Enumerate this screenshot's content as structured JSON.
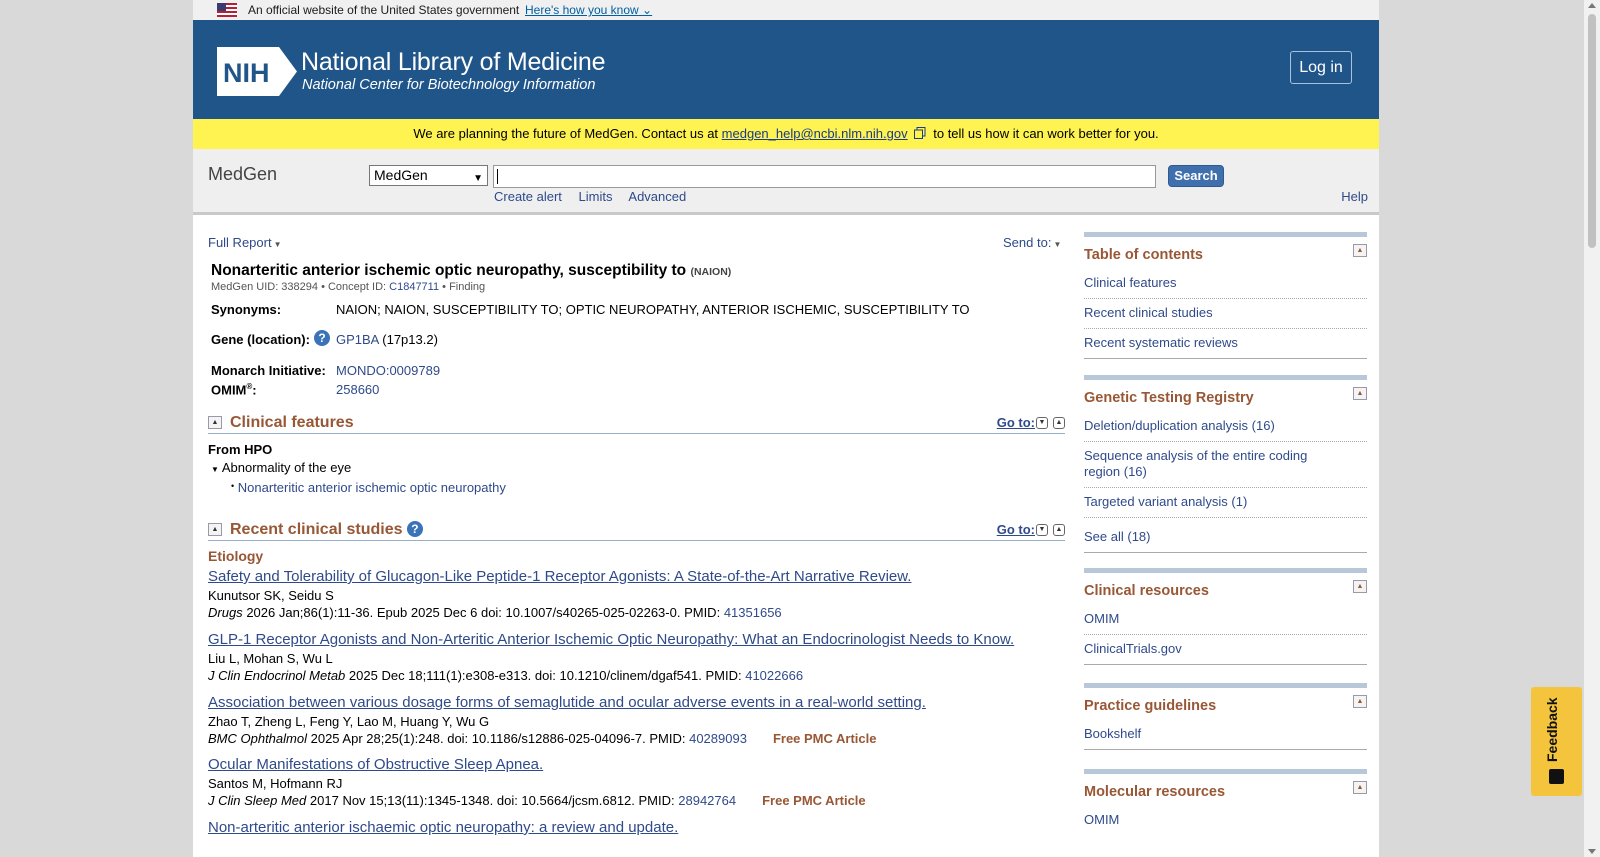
{
  "gov_banner": {
    "text": "An official website of the United States government",
    "link": "Here's how you know"
  },
  "header": {
    "logo_text": "NIH",
    "title": "National Library of Medicine",
    "subtitle": "National Center for Biotechnology Information",
    "login": "Log in"
  },
  "notice": {
    "before": "We are planning the future of MedGen. Contact us at",
    "email": "medgen_help@ncbi.nlm.nih.gov",
    "after": "to tell us how it can work better for you."
  },
  "search": {
    "db_name": "MedGen",
    "db_selected": "MedGen",
    "value": "",
    "button": "Search",
    "links": [
      "Create alert",
      "Limits",
      "Advanced"
    ],
    "help": "Help"
  },
  "report": {
    "format": "Full Report",
    "send_to": "Send to:",
    "title": "Nonarteritic anterior ischemic optic neuropathy, susceptibility to",
    "abbrev": "(NAION)",
    "uid_label": "MedGen UID: 338294",
    "concept_label": "Concept ID:",
    "concept_id": "C1847711",
    "type": "Finding",
    "synonyms_label": "Synonyms:",
    "synonyms": "NAION; NAION, SUSCEPTIBILITY TO; OPTIC NEUROPATHY, ANTERIOR ISCHEMIC, SUSCEPTIBILITY TO",
    "gene_label": "Gene (location):",
    "gene": "GP1BA",
    "gene_location": "(17p13.2)",
    "monarch_label": "Monarch Initiative:",
    "monarch_id": "MONDO:0009789",
    "omim_label": "OMIM",
    "omim_reg": "®",
    "omim_colon": ":",
    "omim_id": "258660"
  },
  "clinical_features": {
    "heading": "Clinical features",
    "goto": "Go to:",
    "from": "From HPO",
    "parent": "Abnormality of the eye",
    "child": "Nonarteritic anterior ischemic optic neuropathy"
  },
  "recent_studies": {
    "heading": "Recent clinical studies",
    "goto": "Go to:",
    "subheading": "Etiology",
    "items": [
      {
        "title": "Safety and Tolerability of Glucagon-Like Peptide-1 Receptor Agonists: A State-of-the-Art Narrative Review.",
        "authors": "Kunutsor SK, Seidu S",
        "journal": "Drugs",
        "cite": "2026 Jan;86(1):11-36. Epub 2025 Dec 6 doi: 10.1007/s40265-025-02263-0. PMID:",
        "pmid": "41351656",
        "free": ""
      },
      {
        "title": "GLP-1 Receptor Agonists and Non-Arteritic Anterior Ischemic Optic Neuropathy: What an Endocrinologist Needs to Know.",
        "authors": "Liu L, Mohan S, Wu L",
        "journal": "J Clin Endocrinol Metab",
        "cite": "2025 Dec 18;111(1):e308-e313. doi: 10.1210/clinem/dgaf541. PMID:",
        "pmid": "41022666",
        "free": ""
      },
      {
        "title": "Association between various dosage forms of semaglutide and ocular adverse events in a real-world setting.",
        "authors": "Zhao T, Zheng L, Feng Y, Lao M, Huang Y, Wu G",
        "journal": "BMC Ophthalmol",
        "cite": "2025 Apr 28;25(1):248. doi: 10.1186/s12886-025-04096-7. PMID:",
        "pmid": "40289093",
        "free": "Free PMC Article"
      },
      {
        "title": "Ocular Manifestations of Obstructive Sleep Apnea.",
        "authors": "Santos M, Hofmann RJ",
        "journal": "J Clin Sleep Med",
        "cite": "2017 Nov 15;13(11):1345-1348. doi: 10.5664/jcsm.6812. PMID:",
        "pmid": "28942764",
        "free": "Free PMC Article"
      },
      {
        "title": "Non-arteritic anterior ischaemic optic neuropathy: a review and update.",
        "authors": "",
        "journal": "",
        "cite": "",
        "pmid": "",
        "free": ""
      }
    ]
  },
  "sidebar": {
    "toc": {
      "heading": "Table of contents",
      "items": [
        "Clinical features",
        "Recent clinical studies",
        "Recent systematic reviews"
      ]
    },
    "gtr": {
      "heading": "Genetic Testing Registry",
      "items": [
        "Deletion/duplication analysis (16)",
        "Sequence analysis of the entire coding region (16)",
        "Targeted variant analysis (1)"
      ],
      "see_all": "See all (18)"
    },
    "clinical": {
      "heading": "Clinical resources",
      "items": [
        "OMIM",
        "ClinicalTrials.gov"
      ]
    },
    "practice": {
      "heading": "Practice guidelines",
      "items": [
        "Bookshelf"
      ]
    },
    "molecular": {
      "heading": "Molecular resources",
      "items": [
        "OMIM"
      ]
    }
  },
  "feedback": "Feedback"
}
